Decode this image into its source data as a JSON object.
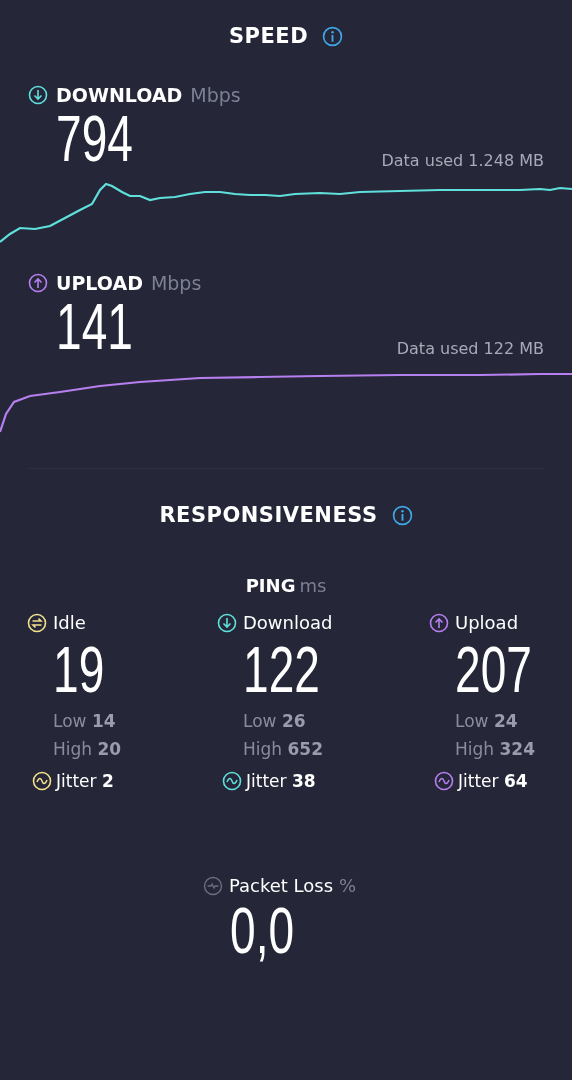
{
  "speed": {
    "title": "SPEED",
    "sections": [
      {
        "kind": "download",
        "label": "DOWNLOAD",
        "unit": "Mbps",
        "value": "794",
        "data_used": "Data used 1.248 MB",
        "color": "#5fe0dc"
      },
      {
        "kind": "upload",
        "label": "UPLOAD",
        "unit": "Mbps",
        "value": "141",
        "data_used": "Data used 122 MB",
        "color": "#b67ff0"
      }
    ]
  },
  "responsiveness": {
    "title": "RESPONSIVENESS",
    "ping_label": "PING",
    "ping_unit": "ms",
    "columns": [
      {
        "kind": "idle",
        "label": "Idle",
        "value": "19",
        "low_label": "Low",
        "low": "14",
        "high_label": "High",
        "high": "20",
        "jitter_label": "Jitter",
        "jitter": "2",
        "color": "#f2e08c"
      },
      {
        "kind": "download",
        "label": "Download",
        "value": "122",
        "low_label": "Low",
        "low": "26",
        "high_label": "High",
        "high": "652",
        "jitter_label": "Jitter",
        "jitter": "38",
        "color": "#5fe0dc"
      },
      {
        "kind": "upload",
        "label": "Upload",
        "value": "207",
        "low_label": "Low",
        "low": "24",
        "high_label": "High",
        "high": "324",
        "jitter_label": "Jitter",
        "jitter": "64",
        "color": "#b67ff0"
      }
    ]
  },
  "packet_loss": {
    "label": "Packet Loss",
    "unit": "%",
    "value": "0,0"
  }
}
